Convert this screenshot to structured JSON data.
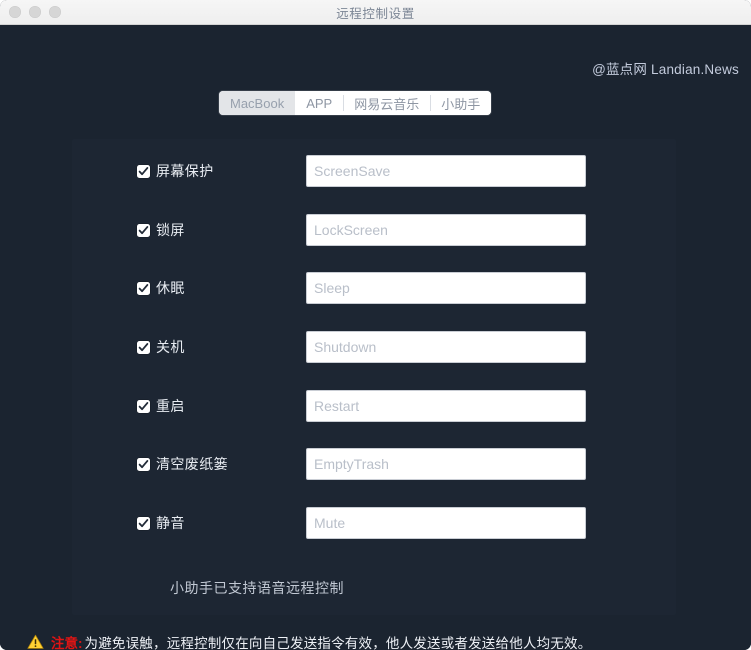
{
  "window": {
    "title": "远程控制设置",
    "traffic_lights": [
      "close",
      "minimize",
      "zoom"
    ]
  },
  "watermark": "@蓝点网 Landian.News",
  "tabs": [
    {
      "label": "MacBook",
      "selected": true
    },
    {
      "label": "APP",
      "selected": false
    },
    {
      "label": "网易云音乐",
      "selected": false
    },
    {
      "label": "小助手",
      "selected": false
    }
  ],
  "settings": {
    "rows": [
      {
        "label": "屏幕保护",
        "checked": true,
        "placeholder": "ScreenSave",
        "value": ""
      },
      {
        "label": "锁屏",
        "checked": true,
        "placeholder": "LockScreen",
        "value": ""
      },
      {
        "label": "休眠",
        "checked": true,
        "placeholder": "Sleep",
        "value": ""
      },
      {
        "label": "关机",
        "checked": true,
        "placeholder": "Shutdown",
        "value": ""
      },
      {
        "label": "重启",
        "checked": true,
        "placeholder": "Restart",
        "value": ""
      },
      {
        "label": "清空废纸篓",
        "checked": true,
        "placeholder": "EmptyTrash",
        "value": ""
      },
      {
        "label": "静音",
        "checked": true,
        "placeholder": "Mute",
        "value": ""
      }
    ]
  },
  "footer_note": "小助手已支持语音远程控制",
  "warning": {
    "icon": "warning-triangle-icon",
    "strong": "注意:",
    "text": "为避免误触，远程控制仅在向自己发送指令有效，他人发送或者发送给他人均无效。"
  },
  "colors": {
    "window_bg": "#1b2430",
    "panel_bg": "#1d2633",
    "titlebar_bg": "#f1f1f1",
    "accent_warning": "#e01414",
    "warning_icon": "#ffd233",
    "field_bg": "#ffffff",
    "placeholder": "#b9bfc9"
  }
}
